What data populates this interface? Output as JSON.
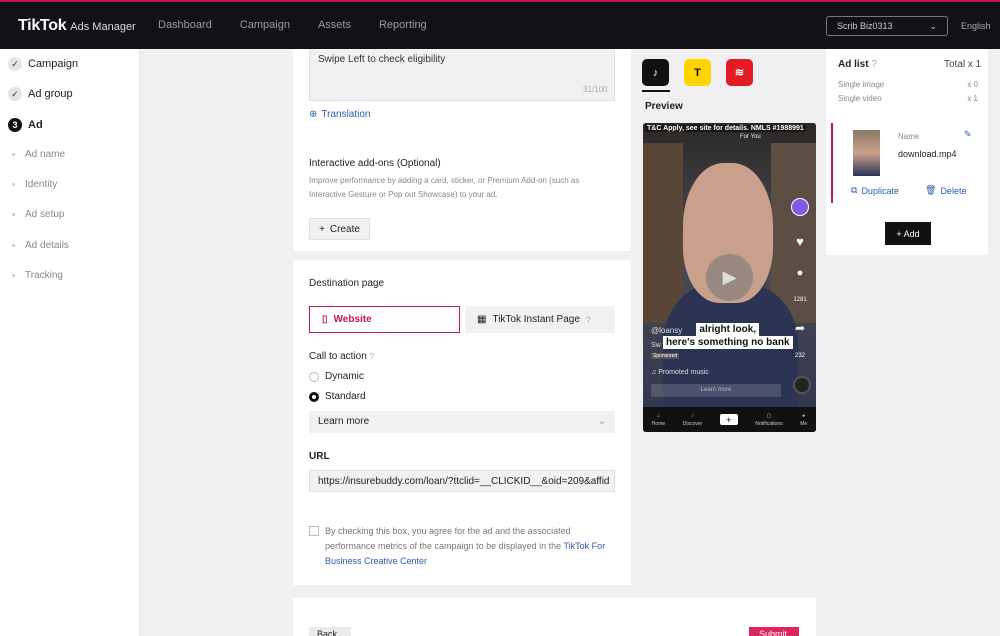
{
  "header": {
    "brand": "TikTok",
    "product": "Ads Manager",
    "nav": [
      "Dashboard",
      "Campaign",
      "Assets",
      "Reporting"
    ],
    "account": "Scrib Biz0313",
    "language": "English"
  },
  "sidebar": {
    "steps": [
      {
        "label": "Campaign",
        "marker": "✓"
      },
      {
        "label": "Ad group",
        "marker": "✓"
      },
      {
        "label": "Ad",
        "marker": "3"
      }
    ],
    "substeps": [
      "Ad name",
      "Identity",
      "Ad setup",
      "Ad details",
      "Tracking"
    ]
  },
  "form": {
    "ad_text_value": "Swipe Left to check eligibility",
    "ad_text_counter": "31/100",
    "translation_link": "Translation",
    "addons_title": "Interactive add-ons (Optional)",
    "addons_help": "Improve performance by adding a card, sticker, or Premium Add-on (such as Interactive Gesture or Pop out Showcase) to your ad.",
    "create_button": "Create",
    "destination_title": "Destination page",
    "destination_website": "Website",
    "destination_instant": "TikTok Instant Page",
    "cta_title": "Call to action",
    "cta_options": [
      "Dynamic",
      "Standard"
    ],
    "cta_selected_value": "Learn more",
    "url_title": "URL",
    "url_value": "https://insurebuddy.com/loan/?ttclid=__CLICKID__&oid=209&affid",
    "agree_text": "By checking this box, you agree for the ad and the associated performance metrics of the campaign to be displayed in the",
    "agree_link": "TikTok For Business Creative Center"
  },
  "preview": {
    "label": "Preview",
    "placements": [
      "tiktok-icon",
      "topbuzz-icon",
      "pangle-icon"
    ],
    "disclaimer": "T&C Apply, see site for details. NMLS #1988991",
    "for_you": "For You",
    "handle": "@loansy",
    "caption_sub": "Sw",
    "sponsored": "Sponsored",
    "subtitle_lines": [
      "alright look,",
      "here's something no bank"
    ],
    "music": "Promoted music",
    "learn_more": "Learn more",
    "side_counts": [
      "1281",
      "232"
    ],
    "tabs": [
      "Home",
      "Discover",
      "",
      "Notifications",
      "Me"
    ]
  },
  "adlist": {
    "title": "Ad list",
    "total": "Total x 1",
    "rows": [
      {
        "label": "Single image",
        "count": "x 0"
      },
      {
        "label": "Single video",
        "count": "x 1"
      }
    ],
    "item": {
      "name_label": "Name",
      "file": "download.mp4",
      "duplicate": "Duplicate",
      "delete": "Delete"
    },
    "add_button": "+ Add"
  },
  "footer": {
    "back": "Back",
    "submit": "Submit"
  },
  "colors": {
    "accent": "#c2185b",
    "topbar": "#121216",
    "link": "#2a5db0"
  }
}
